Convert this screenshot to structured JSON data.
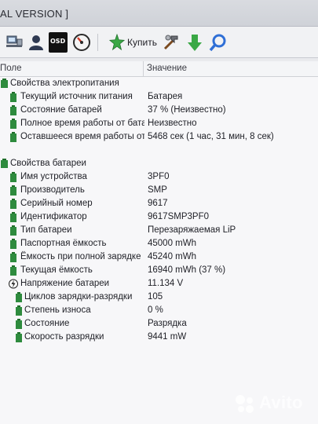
{
  "window": {
    "title": "AL VERSION ]"
  },
  "toolbar": {
    "buy_label": "Купить",
    "icons": [
      "hardware-icon",
      "user-icon",
      "osd-icon",
      "gauge-icon",
      "buy-star-icon",
      "tools-icon",
      "download-arrow-icon",
      "search-icon"
    ],
    "osd_text": "OSD"
  },
  "columns": {
    "field": "Поле",
    "value": "Значение"
  },
  "groups": [
    {
      "title": "Свойства электропитания",
      "rows": [
        {
          "name": "Текущий источник питания",
          "value": "Батарея"
        },
        {
          "name": "Состояние батарей",
          "value": "37 % (Неизвестно)"
        },
        {
          "name": "Полное время работы от батар...",
          "value": "Неизвестно"
        },
        {
          "name": "Оставшееся время работы от б...",
          "value": "5468 сек (1 час, 31 мин, 8 сек)"
        }
      ]
    },
    {
      "title": "Свойства батареи",
      "rows": [
        {
          "name": "Имя устройства",
          "value": "3PF0"
        },
        {
          "name": "Производитель",
          "value": "SMP"
        },
        {
          "name": "Серийный номер",
          "value": "9617"
        },
        {
          "name": "Идентификатор",
          "value": "9617SMP3PF0"
        },
        {
          "name": "Тип батареи",
          "value": "Перезаряжаемая LiP"
        },
        {
          "name": "Паспортная ёмкость",
          "value": "45000 mWh"
        },
        {
          "name": "Ёмкость при полной зарядке",
          "value": "45240 mWh"
        },
        {
          "name": "Текущая ёмкость",
          "value": "16940 mWh  (37 %)"
        },
        {
          "name": "Напряжение батареи",
          "value": "11.134 V"
        },
        {
          "name": "Циклов зарядки-разрядки",
          "value": "105"
        },
        {
          "name": "Степень износа",
          "value": "0 %"
        },
        {
          "name": "Состояние",
          "value": "Разрядка"
        },
        {
          "name": "Скорость разрядки",
          "value": "9441 mW"
        }
      ]
    }
  ],
  "watermark": {
    "text": "Avito"
  },
  "colors": {
    "accent_green": "#3aa845",
    "icon_green": "#2e8b3e",
    "search_blue": "#2f6fd6"
  }
}
